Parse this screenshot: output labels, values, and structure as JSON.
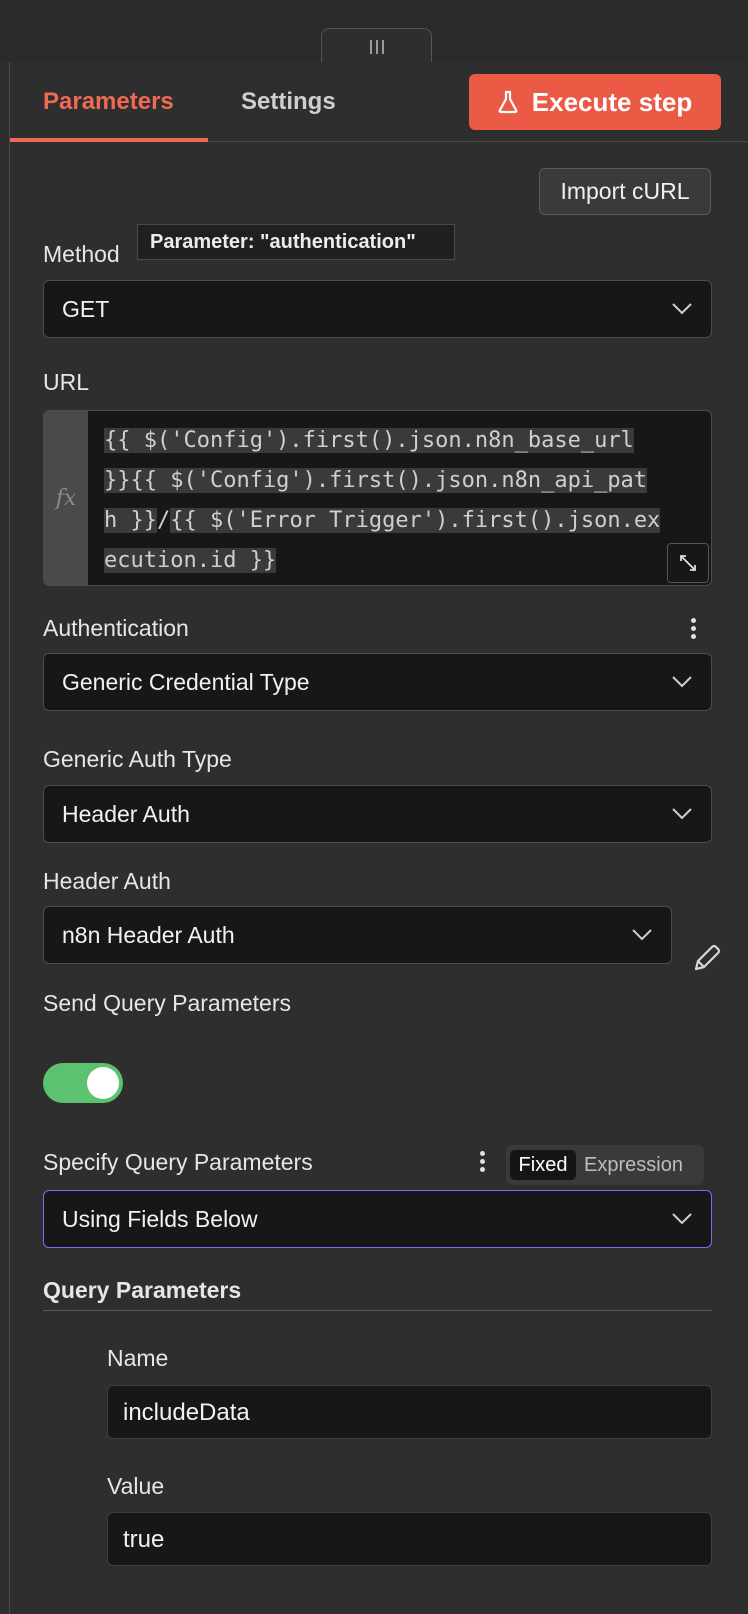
{
  "tabs": {
    "parameters": "Parameters",
    "settings": "Settings"
  },
  "actions": {
    "execute_step": "Execute step",
    "import_curl": "Import cURL"
  },
  "tooltip": "Parameter: \"authentication\"",
  "method": {
    "label": "Method",
    "value": "GET"
  },
  "url": {
    "label": "URL",
    "line1": "{{ $('Config').first().json.n8n_base_url ",
    "line2": "}}{{ $('Config').first().json.n8n_api_pat",
    "line3a": "h }}",
    "line3b": "/",
    "line3c": "{{ $('Error Trigger').first().json.ex",
    "line4": "ecution.id }}"
  },
  "authentication": {
    "label": "Authentication",
    "value": "Generic Credential Type"
  },
  "generic_auth_type": {
    "label": "Generic Auth Type",
    "value": "Header Auth"
  },
  "header_auth": {
    "label": "Header Auth",
    "value": "n8n Header Auth"
  },
  "send_query_parameters": {
    "label": "Send Query Parameters",
    "enabled": true
  },
  "specify_query_parameters": {
    "label": "Specify Query Parameters",
    "value": "Using Fields Below",
    "mode_fixed": "Fixed",
    "mode_expression": "Expression"
  },
  "query_parameters": {
    "label": "Query Parameters",
    "name_label": "Name",
    "name_value": "includeData",
    "value_label": "Value",
    "value_value": "true"
  },
  "colors": {
    "accent": "#ea5a45",
    "toggle_on": "#5cc26f",
    "focus_border": "#7c6cf0"
  }
}
